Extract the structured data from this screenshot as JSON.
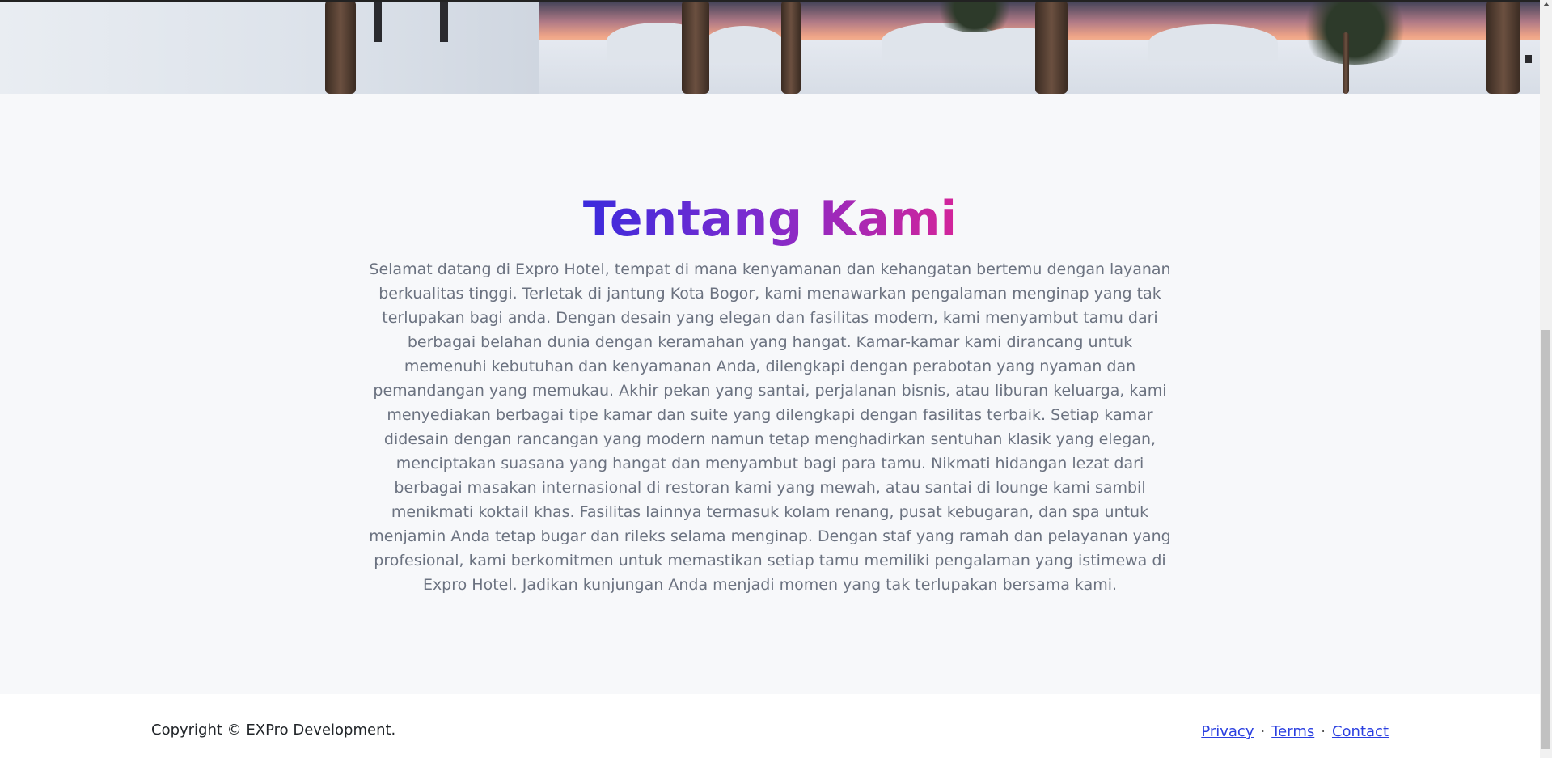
{
  "about": {
    "heading": "Tentang Kami",
    "body": "Selamat datang di Expro Hotel, tempat di mana kenyamanan dan kehangatan bertemu dengan layanan berkualitas tinggi. Terletak di jantung Kota Bogor, kami menawarkan pengalaman menginap yang tak terlupakan bagi anda. Dengan desain yang elegan dan fasilitas modern, kami menyambut tamu dari berbagai belahan dunia dengan keramahan yang hangat. Kamar-kamar kami dirancang untuk memenuhi kebutuhan dan kenyamanan Anda, dilengkapi dengan perabotan yang nyaman dan pemandangan yang memukau. Akhir pekan yang santai, perjalanan bisnis, atau liburan keluarga, kami menyediakan berbagai tipe kamar dan suite yang dilengkapi dengan fasilitas terbaik. Setiap kamar didesain dengan rancangan yang modern namun tetap menghadirkan sentuhan klasik yang elegan, menciptakan suasana yang hangat dan menyambut bagi para tamu. Nikmati hidangan lezat dari berbagai masakan internasional di restoran kami yang mewah, atau santai di lounge kami sambil menikmati koktail khas. Fasilitas lainnya termasuk kolam renang, pusat kebugaran, dan spa untuk menjamin Anda tetap bugar dan rileks selama menginap. Dengan staf yang ramah dan pelayanan yang profesional, kami berkomitmen untuk memastikan setiap tamu memiliki pengalaman yang istimewa di Expro Hotel. Jadikan kunjungan Anda menjadi momen yang tak terlupakan bersama kami."
  },
  "footer": {
    "copyright": "Copyright © EXPro Development.",
    "links": {
      "privacy": "Privacy",
      "terms": "Terms",
      "contact": "Contact",
      "separator": "·"
    }
  },
  "colors": {
    "heading_gradient_start": "#3b2bdc",
    "heading_gradient_end": "#d3259a",
    "body_text": "#6b7280",
    "link": "#2a3fe0",
    "section_bg": "#f7f8fa",
    "footer_bg": "#ffffff"
  }
}
